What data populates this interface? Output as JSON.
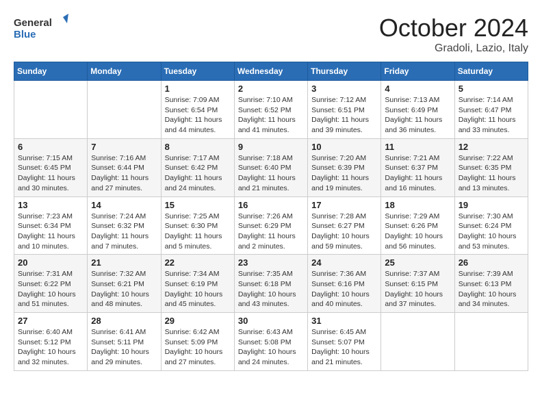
{
  "header": {
    "logo_line1": "General",
    "logo_line2": "Blue",
    "month": "October 2024",
    "location": "Gradoli, Lazio, Italy"
  },
  "weekdays": [
    "Sunday",
    "Monday",
    "Tuesday",
    "Wednesday",
    "Thursday",
    "Friday",
    "Saturday"
  ],
  "weeks": [
    [
      {
        "day": "",
        "info": ""
      },
      {
        "day": "",
        "info": ""
      },
      {
        "day": "1",
        "info": "Sunrise: 7:09 AM\nSunset: 6:54 PM\nDaylight: 11 hours and 44 minutes."
      },
      {
        "day": "2",
        "info": "Sunrise: 7:10 AM\nSunset: 6:52 PM\nDaylight: 11 hours and 41 minutes."
      },
      {
        "day": "3",
        "info": "Sunrise: 7:12 AM\nSunset: 6:51 PM\nDaylight: 11 hours and 39 minutes."
      },
      {
        "day": "4",
        "info": "Sunrise: 7:13 AM\nSunset: 6:49 PM\nDaylight: 11 hours and 36 minutes."
      },
      {
        "day": "5",
        "info": "Sunrise: 7:14 AM\nSunset: 6:47 PM\nDaylight: 11 hours and 33 minutes."
      }
    ],
    [
      {
        "day": "6",
        "info": "Sunrise: 7:15 AM\nSunset: 6:45 PM\nDaylight: 11 hours and 30 minutes."
      },
      {
        "day": "7",
        "info": "Sunrise: 7:16 AM\nSunset: 6:44 PM\nDaylight: 11 hours and 27 minutes."
      },
      {
        "day": "8",
        "info": "Sunrise: 7:17 AM\nSunset: 6:42 PM\nDaylight: 11 hours and 24 minutes."
      },
      {
        "day": "9",
        "info": "Sunrise: 7:18 AM\nSunset: 6:40 PM\nDaylight: 11 hours and 21 minutes."
      },
      {
        "day": "10",
        "info": "Sunrise: 7:20 AM\nSunset: 6:39 PM\nDaylight: 11 hours and 19 minutes."
      },
      {
        "day": "11",
        "info": "Sunrise: 7:21 AM\nSunset: 6:37 PM\nDaylight: 11 hours and 16 minutes."
      },
      {
        "day": "12",
        "info": "Sunrise: 7:22 AM\nSunset: 6:35 PM\nDaylight: 11 hours and 13 minutes."
      }
    ],
    [
      {
        "day": "13",
        "info": "Sunrise: 7:23 AM\nSunset: 6:34 PM\nDaylight: 11 hours and 10 minutes."
      },
      {
        "day": "14",
        "info": "Sunrise: 7:24 AM\nSunset: 6:32 PM\nDaylight: 11 hours and 7 minutes."
      },
      {
        "day": "15",
        "info": "Sunrise: 7:25 AM\nSunset: 6:30 PM\nDaylight: 11 hours and 5 minutes."
      },
      {
        "day": "16",
        "info": "Sunrise: 7:26 AM\nSunset: 6:29 PM\nDaylight: 11 hours and 2 minutes."
      },
      {
        "day": "17",
        "info": "Sunrise: 7:28 AM\nSunset: 6:27 PM\nDaylight: 10 hours and 59 minutes."
      },
      {
        "day": "18",
        "info": "Sunrise: 7:29 AM\nSunset: 6:26 PM\nDaylight: 10 hours and 56 minutes."
      },
      {
        "day": "19",
        "info": "Sunrise: 7:30 AM\nSunset: 6:24 PM\nDaylight: 10 hours and 53 minutes."
      }
    ],
    [
      {
        "day": "20",
        "info": "Sunrise: 7:31 AM\nSunset: 6:22 PM\nDaylight: 10 hours and 51 minutes."
      },
      {
        "day": "21",
        "info": "Sunrise: 7:32 AM\nSunset: 6:21 PM\nDaylight: 10 hours and 48 minutes."
      },
      {
        "day": "22",
        "info": "Sunrise: 7:34 AM\nSunset: 6:19 PM\nDaylight: 10 hours and 45 minutes."
      },
      {
        "day": "23",
        "info": "Sunrise: 7:35 AM\nSunset: 6:18 PM\nDaylight: 10 hours and 43 minutes."
      },
      {
        "day": "24",
        "info": "Sunrise: 7:36 AM\nSunset: 6:16 PM\nDaylight: 10 hours and 40 minutes."
      },
      {
        "day": "25",
        "info": "Sunrise: 7:37 AM\nSunset: 6:15 PM\nDaylight: 10 hours and 37 minutes."
      },
      {
        "day": "26",
        "info": "Sunrise: 7:39 AM\nSunset: 6:13 PM\nDaylight: 10 hours and 34 minutes."
      }
    ],
    [
      {
        "day": "27",
        "info": "Sunrise: 6:40 AM\nSunset: 5:12 PM\nDaylight: 10 hours and 32 minutes."
      },
      {
        "day": "28",
        "info": "Sunrise: 6:41 AM\nSunset: 5:11 PM\nDaylight: 10 hours and 29 minutes."
      },
      {
        "day": "29",
        "info": "Sunrise: 6:42 AM\nSunset: 5:09 PM\nDaylight: 10 hours and 27 minutes."
      },
      {
        "day": "30",
        "info": "Sunrise: 6:43 AM\nSunset: 5:08 PM\nDaylight: 10 hours and 24 minutes."
      },
      {
        "day": "31",
        "info": "Sunrise: 6:45 AM\nSunset: 5:07 PM\nDaylight: 10 hours and 21 minutes."
      },
      {
        "day": "",
        "info": ""
      },
      {
        "day": "",
        "info": ""
      }
    ]
  ]
}
